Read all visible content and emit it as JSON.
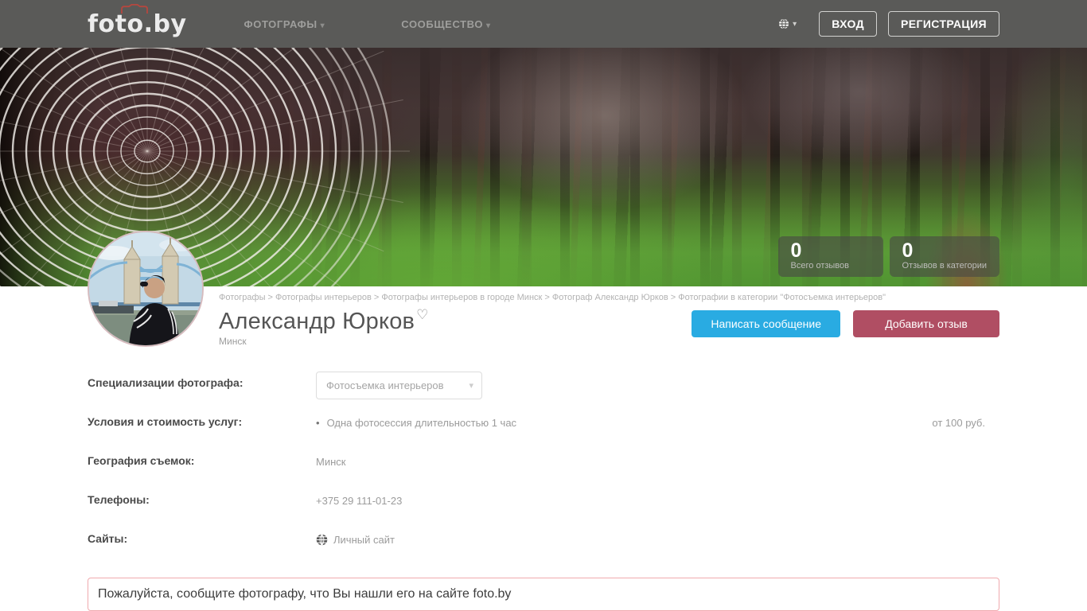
{
  "navbar": {
    "logo": "foto.by",
    "menu_photographers": "ФОТОГРАФЫ",
    "menu_community": "СООБЩЕСТВО",
    "login_label": "ВХОД",
    "register_label": "РЕГИСТРАЦИЯ"
  },
  "hero": {
    "stats": [
      {
        "value": "0",
        "label": "Всего отзывов"
      },
      {
        "value": "0",
        "label": "Отзывов в категории"
      }
    ]
  },
  "profile": {
    "breadcrumb": "Фотографы > Фотографы интерьеров > Фотографы интерьеров в городе Минск > Фотограф Александр Юрков > Фотографии в категории \"Фотосъемка интерьеров\"",
    "name": "Александр Юрков",
    "city": "Минск",
    "message_button": "Написать сообщение",
    "review_button": "Добавить отзыв"
  },
  "details": {
    "specialization_label": "Специализации фотографа:",
    "specialization_value": "Фотосъемка интерьеров",
    "pricing_label": "Условия и стоимость услуг:",
    "pricing_item": "Одна фотосессия длительностью 1 час",
    "pricing_price": "от 100 руб.",
    "geography_label": "География съемок:",
    "geography_value": "Минск",
    "phones_label": "Телефоны:",
    "phones_value": "+375 29 111-01-23",
    "sites_label": "Сайты:",
    "sites_value": "Личный сайт"
  },
  "notice_text": "Пожалуйста, сообщите фотографу, что Вы нашли его на сайте foto.by",
  "icons": {
    "caret_down": "▾",
    "heart_outline": "♡",
    "bullet": "•"
  },
  "colors": {
    "accent_blue": "#29abe2",
    "accent_red": "#b04e63",
    "navbar_bg": "#5a5a58",
    "logo_camera_red": "#b5473f"
  }
}
